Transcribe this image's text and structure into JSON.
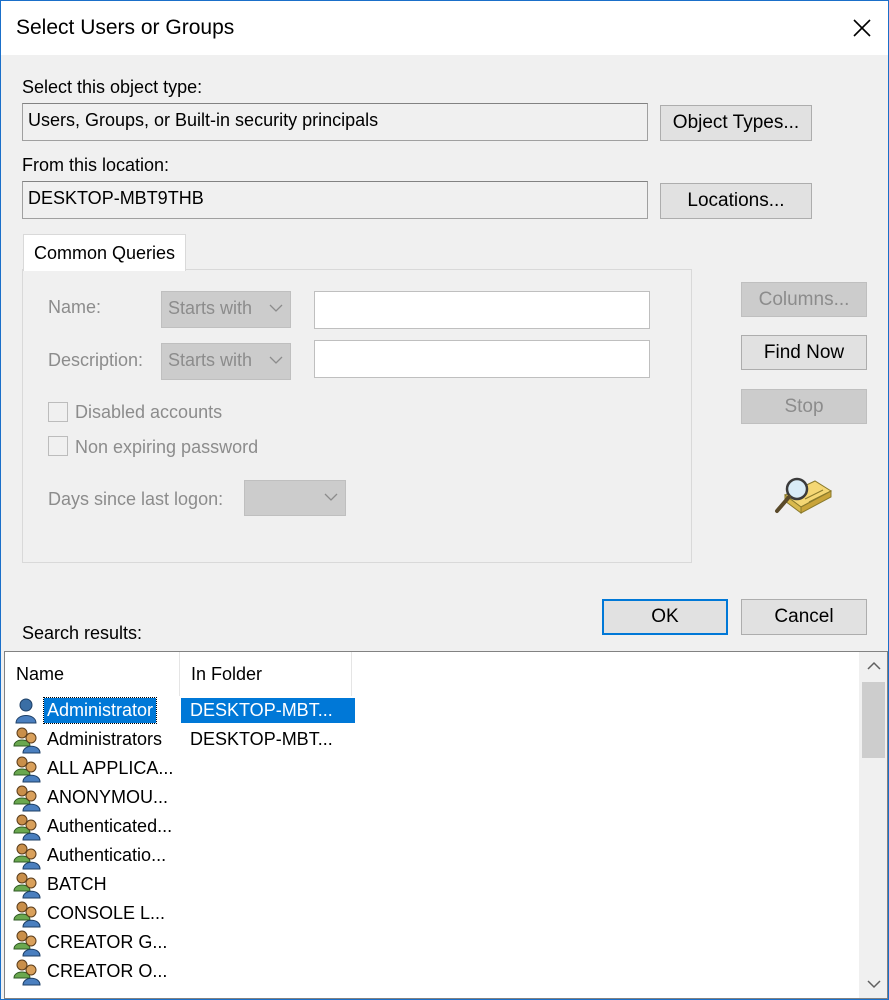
{
  "dialog": {
    "title": "Select Users or Groups",
    "close_icon": "close-icon"
  },
  "object_type": {
    "label": "Select this object type:",
    "value": "Users, Groups, or Built-in security principals",
    "button": "Object Types..."
  },
  "location": {
    "label": "From this location:",
    "value": "DESKTOP-MBT9THB",
    "button": "Locations..."
  },
  "common_queries": {
    "tab_label": "Common Queries",
    "name_label": "Name:",
    "name_mode": "Starts with",
    "name_value": "",
    "description_label": "Description:",
    "description_mode": "Starts with",
    "description_value": "",
    "disabled_accounts": {
      "label": "Disabled accounts",
      "checked": false
    },
    "non_expiring_password": {
      "label": "Non expiring password",
      "checked": false
    },
    "days_label": "Days since last logon:",
    "days_value": ""
  },
  "side_buttons": {
    "columns": "Columns...",
    "find_now": "Find Now",
    "stop": "Stop",
    "search_icon": "search-folder-icon"
  },
  "actions": {
    "ok": "OK",
    "cancel": "Cancel"
  },
  "results": {
    "label": "Search results:",
    "columns": [
      "Name",
      "In Folder"
    ],
    "rows": [
      {
        "name": "Administrator",
        "folder": "DESKTOP-MBT...",
        "icon": "user-icon",
        "selected": true
      },
      {
        "name": "Administrators",
        "folder": "DESKTOP-MBT...",
        "icon": "group-icon",
        "selected": false
      },
      {
        "name": "ALL APPLICA...",
        "folder": "",
        "icon": "group-icon",
        "selected": false
      },
      {
        "name": "ANONYMOU...",
        "folder": "",
        "icon": "group-icon",
        "selected": false
      },
      {
        "name": "Authenticated...",
        "folder": "",
        "icon": "group-icon",
        "selected": false
      },
      {
        "name": "Authenticatio...",
        "folder": "",
        "icon": "group-icon",
        "selected": false
      },
      {
        "name": "BATCH",
        "folder": "",
        "icon": "group-icon",
        "selected": false
      },
      {
        "name": "CONSOLE L...",
        "folder": "",
        "icon": "group-icon",
        "selected": false
      },
      {
        "name": "CREATOR G...",
        "folder": "",
        "icon": "group-icon",
        "selected": false
      },
      {
        "name": "CREATOR O...",
        "folder": "",
        "icon": "group-icon",
        "selected": false
      }
    ]
  },
  "colors": {
    "accent": "#0078d7",
    "disabled_text": "#8c8c8c",
    "window_border": "#1a6fc9"
  }
}
